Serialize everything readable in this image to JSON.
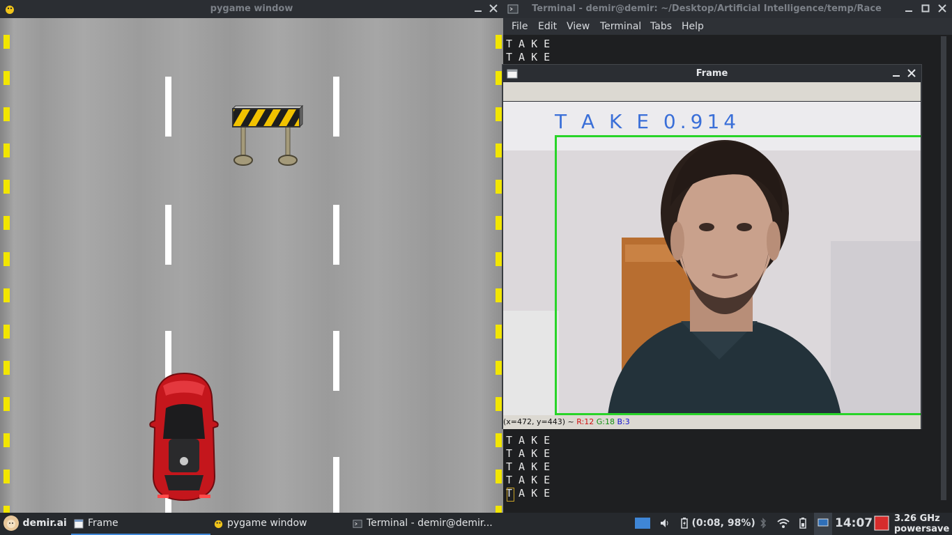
{
  "pygame": {
    "title": "pygame window"
  },
  "terminal": {
    "title": "Terminal - demir@demir: ~/Desktop/Artificial Intelligence/temp/Race",
    "menu": [
      "File",
      "Edit",
      "View",
      "Terminal",
      "Tabs",
      "Help"
    ],
    "output_top": "T A K E\nT A K E",
    "output_bottom": "T A K E\nT A K E\nT A K E\nT A K E\nT A K E"
  },
  "frame": {
    "title": "Frame",
    "detection_label": "T A K E 0.914",
    "status": {
      "coords": "(x=472, y=443) ~ ",
      "r": "R:12",
      "g": "G:18",
      "b": "B:3"
    }
  },
  "taskbar": {
    "start_label": "demir.ai",
    "tasks": [
      "Frame",
      "pygame window",
      "Terminal - demir@demir..."
    ],
    "battery": "(0:08, 98%)",
    "clock": "14:07",
    "cpu_freq": "3.26 GHz",
    "cpu_governor": "powersave"
  },
  "colors": {
    "edge_line": "#f2e600",
    "detection_box": "#28d428",
    "detection_text": "#3a6fd8",
    "car": "#c4161c",
    "active_task_underline": "#3f86d6"
  }
}
